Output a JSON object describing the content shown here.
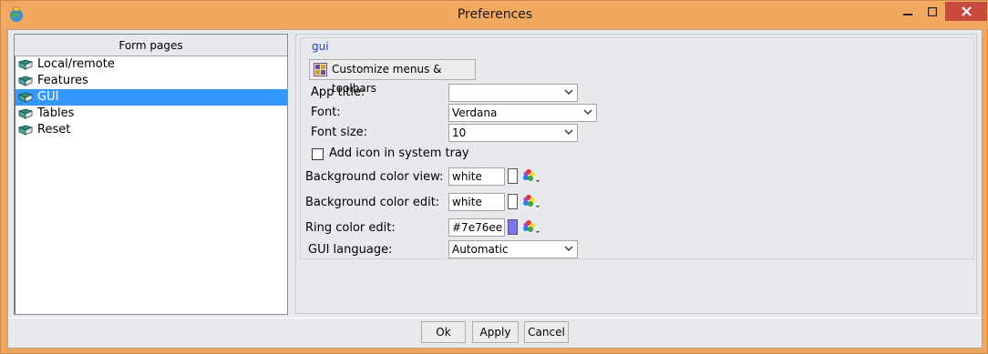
{
  "window": {
    "title": "Preferences"
  },
  "tree": {
    "header": "Form pages",
    "items": [
      {
        "label": "Local/remote"
      },
      {
        "label": "Features"
      },
      {
        "label": "GUI"
      },
      {
        "label": "Tables"
      },
      {
        "label": "Reset"
      }
    ],
    "selected": "GUI"
  },
  "gui": {
    "group_title": "gui",
    "customize_label": "Customize menus & toolbars",
    "app_title_label": "App title:",
    "app_title_value": "",
    "font_label": "Font:",
    "font_value": "Verdana",
    "font_size_label": "Font size:",
    "font_size_value": "10",
    "tray_label": "Add icon in system tray",
    "tray_checked": false,
    "bg_view_label": "Background color view:",
    "bg_view_value": "white",
    "bg_view_color": "#ffffff",
    "bg_edit_label": "Background color edit:",
    "bg_edit_value": "white",
    "bg_edit_color": "#ffffff",
    "ring_label": "Ring color edit:",
    "ring_value": "#7e76ee",
    "ring_color": "#7e76ee",
    "language_label": "GUI language:",
    "language_value": "Automatic"
  },
  "buttons": {
    "ok": "Ok",
    "apply": "Apply",
    "cancel": "Cancel"
  },
  "colors": {
    "title_bar": "#f3a860",
    "selection": "#3399ff",
    "group_title": "#1c3bd6",
    "close_button": "#c74a3c"
  }
}
